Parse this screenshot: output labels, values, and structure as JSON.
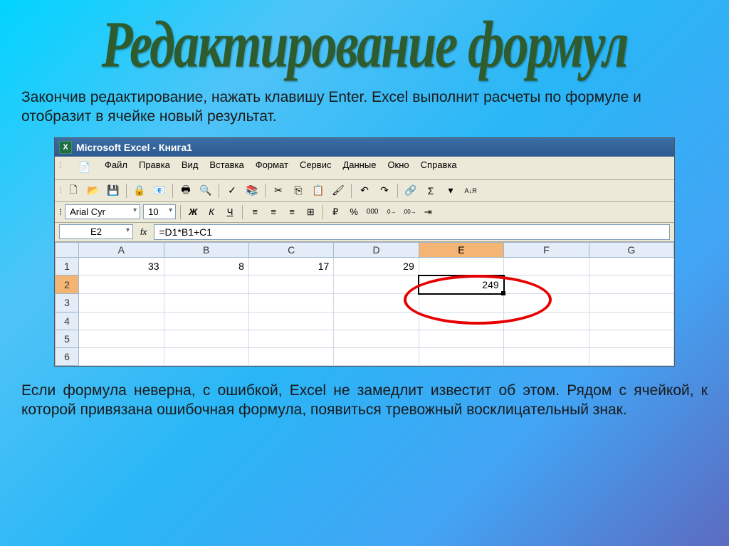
{
  "slide": {
    "title": "Редактирование формул",
    "text_top": "Закончив редактирование, нажать клавишу Enter. Excel выполнит расчеты по формуле и отобразит в ячейке новый результат.",
    "text_bottom": "Если формула неверна, с ошибкой, Excel не замедлит известит об этом. Рядом с ячейкой, к которой привязана ошибочная формула, появиться тревожный восклицательный знак."
  },
  "excel": {
    "title": "Microsoft Excel - Книга1",
    "menu": [
      "Файл",
      "Правка",
      "Вид",
      "Вставка",
      "Формат",
      "Сервис",
      "Данные",
      "Окно",
      "Справка"
    ],
    "font_name": "Arial Cyr",
    "font_size": "10",
    "cell_ref": "E2",
    "fx_label": "fx",
    "formula": "=D1*B1+C1",
    "columns": [
      "A",
      "B",
      "C",
      "D",
      "E",
      "F",
      "G"
    ],
    "rows": [
      "1",
      "2",
      "3",
      "4",
      "5",
      "6"
    ],
    "data": {
      "A1": "33",
      "B1": "8",
      "C1": "17",
      "D1": "29",
      "E2": "249"
    },
    "icons": {
      "sigma": "Σ",
      "sort": "А↓Я",
      "percent": "%",
      "thousands": "000",
      "currency": "₽",
      "dec_inc": ".00→.0",
      "dec_dec": ".0→.00"
    }
  }
}
